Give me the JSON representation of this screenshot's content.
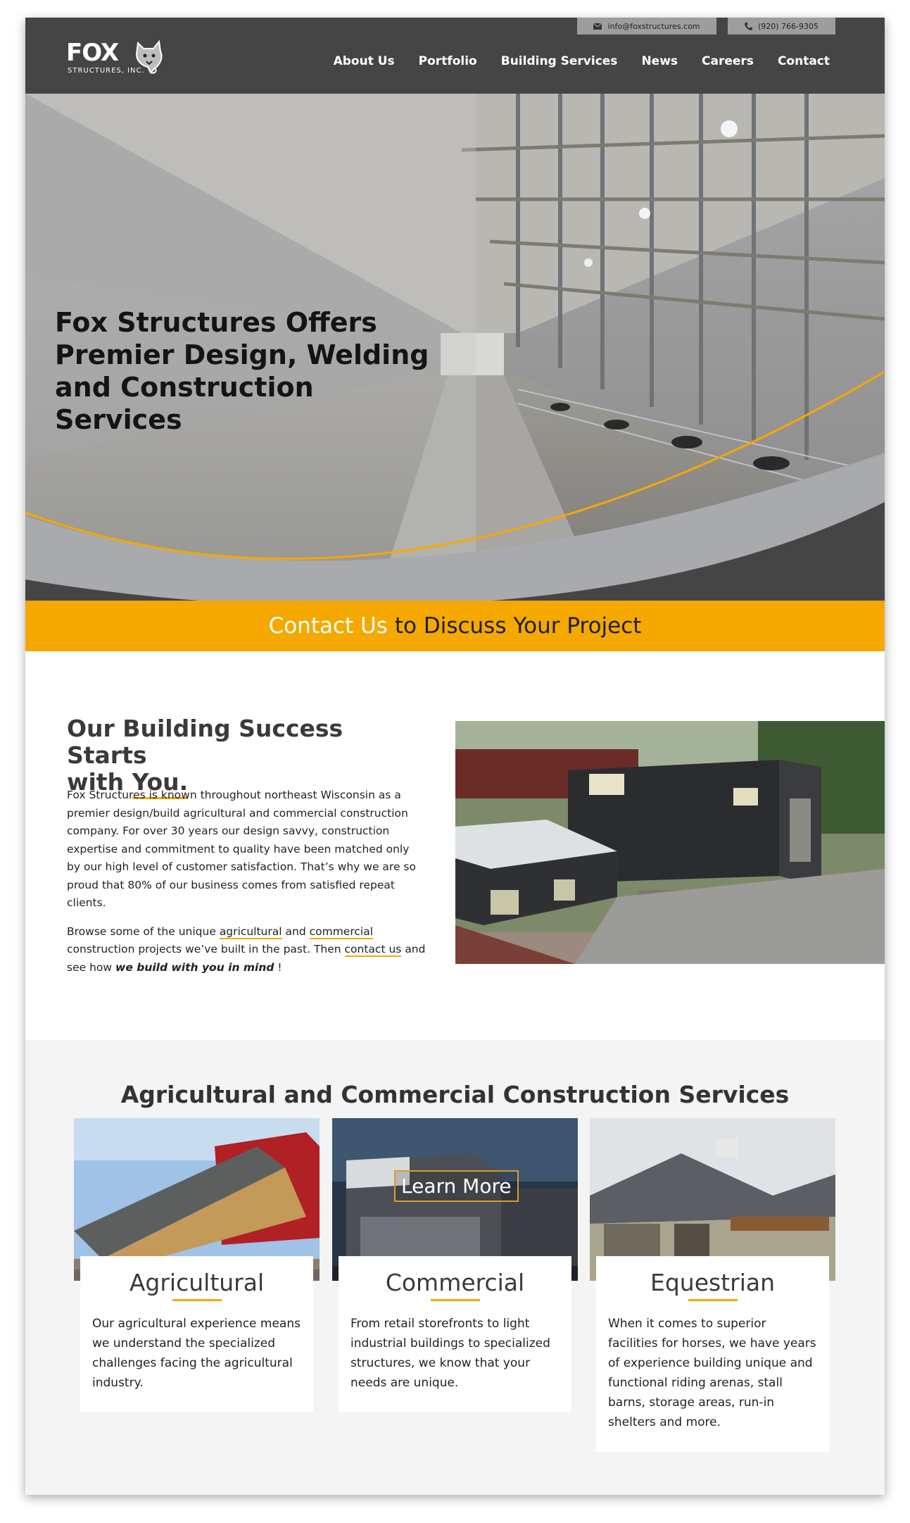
{
  "header": {
    "email": "info@foxstructures.com",
    "phone": "(920) 766-9305",
    "logo_text": "FOX",
    "logo_subtext": "STRUCTURES, INC.",
    "nav": [
      "About Us",
      "Portfolio",
      "Building Services",
      "News",
      "Careers",
      "Contact"
    ]
  },
  "hero": {
    "title": "Fox Structures Offers Premier Design, Welding and Construction Services"
  },
  "cta": {
    "link": "Contact Us",
    "rest": "to Discuss Your Project"
  },
  "intro": {
    "title_line1": "Our Building Success Starts",
    "title_with": "with",
    "title_you": "You.",
    "para1": "Fox Structures is known throughout northeast Wisconsin as a premier design/build agricultural and commercial construction company. For over 30 years our design savvy, construction expertise and commitment to quality have been matched only by our high level of customer satisfaction. That’s why we are so proud that 80% of our business comes from satisfied repeat clients.",
    "para2_a": "Browse some of the unique",
    "para2_link1": "agricultural",
    "para2_b": "and",
    "para2_link2": "commercial",
    "para2_c": "construction projects we’ve built in the past. Then",
    "para2_link3": "contact us",
    "para2_d": "and see how",
    "para2_em": "we build with you in mind",
    "para2_e": "!"
  },
  "services": {
    "title": "Agricultural and Commercial Construction Services",
    "learn_more": "Learn More",
    "cards": [
      {
        "title": "Agricultural",
        "text": "Our agricultural experience means we understand the specialized challenges facing the agricultural industry."
      },
      {
        "title": "Commercial",
        "text": "From retail storefronts to light industrial buildings to specialized structures, we know that your needs are unique."
      },
      {
        "title": "Equestrian",
        "text": "When it comes to superior facilities for horses, we have years of experience building unique and functional riding arenas, stall barns, storage areas, run-in shelters and more."
      }
    ]
  },
  "colors": {
    "accent": "#f5a800",
    "header_bg": "#454545",
    "topbar_bg": "#9d9d9d"
  }
}
